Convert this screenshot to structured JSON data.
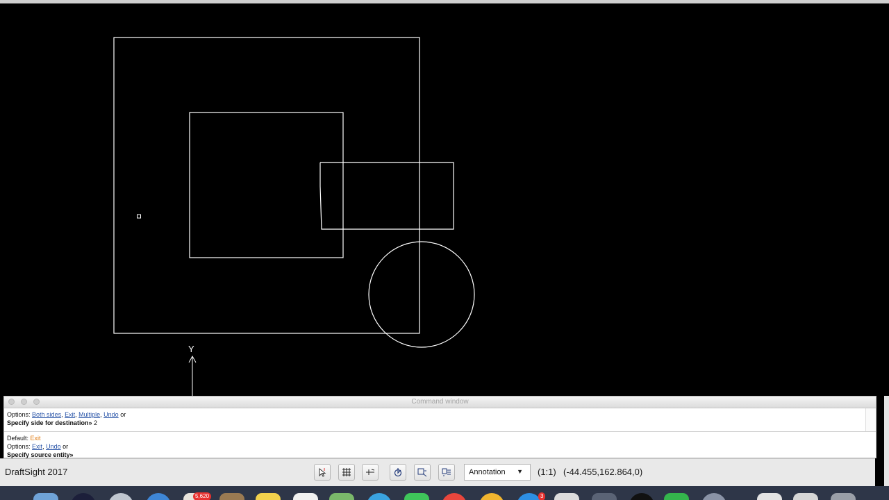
{
  "command_window": {
    "title": "Command window",
    "history": {
      "options_prefix": "Options:",
      "options": [
        "Both sides",
        "Exit",
        "Multiple",
        "Undo"
      ],
      "options_suffix": "or",
      "prompt": "Specify side for destination»",
      "entered_value": "2"
    },
    "current": {
      "default_prefix": "Default:",
      "default_value": "Exit",
      "options_prefix": "Options:",
      "options": [
        "Exit",
        "Undo"
      ],
      "options_suffix": "or",
      "prompt": "Specify source entity»"
    }
  },
  "statusbar": {
    "app_name": "DraftSight 2017",
    "toolbar_icons": [
      "select-icon",
      "grid-icon",
      "ortho-icon",
      "polar-icon",
      "esnap-icon",
      "etrack-icon"
    ],
    "annotation_scale": "Annotation",
    "scale_ratio": "(1:1)",
    "coordinates": "(-44.455,162.864,0)"
  },
  "drawing": {
    "ucs_y_label": "Y"
  },
  "dock": {
    "badges": [
      "5,620",
      "3"
    ]
  },
  "colors": {
    "canvas_background": "#000000",
    "entity_stroke": "#ffffff",
    "option_link": "#2a55a8",
    "default_value": "#e07b12"
  }
}
